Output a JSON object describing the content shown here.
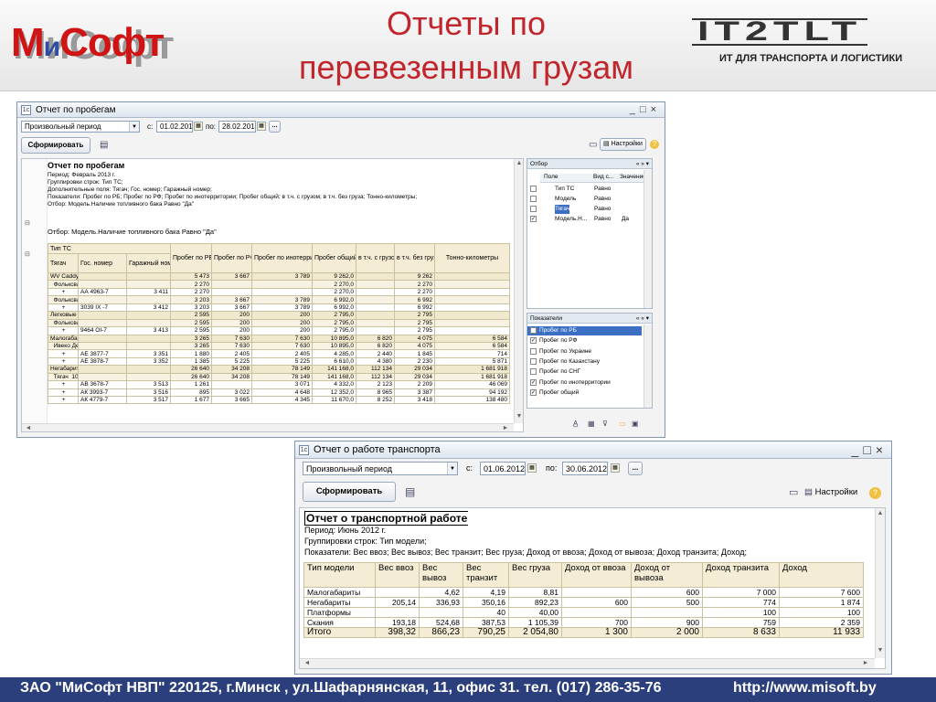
{
  "slide": {
    "logo_left": {
      "m": "М",
      "i": "и",
      "rest": "Софт"
    },
    "title_line1": "Отчеты по",
    "title_line2": "перевезенным грузам",
    "logo_right": {
      "mark": "IT2TLT",
      "subtitle": "ИТ ДЛЯ ТРАНСПОРТА И ЛОГИСТИКИ"
    },
    "footer_left": "ЗАО \"МиСофт НВП\"  220125, г.Минск , ул.Шафарнянская, 11, офис 31. тел. (017) 286-35-76",
    "footer_right": "http://www.misoft.by"
  },
  "win1": {
    "title": "Отчет по пробегам",
    "period_select": "Произвольный период",
    "from_label": "с:",
    "from_date": "01.02.2013",
    "to_label": "по:",
    "to_date": "28.02.2013",
    "ellipsis": "...",
    "generate_button": "Сформировать",
    "settings_button": "Настройки",
    "report": {
      "title": "Отчет по пробегам",
      "lines": [
        "Период: Февраль 2013 г.",
        "Группировки строк: Тип ТС;",
        "Дополнительные поля: Тягач; Гос. номер; Гаражный номер;",
        "Показатели: Пробег по РБ; Пробег по РФ; Пробег по инотерритории; Пробег общий; в т.ч. с грузом; в т.ч. без груза; Тонно-километры;",
        "Отбор: Модель.Наличие топливного бака Равно \"Да\""
      ],
      "filter_line": "Отбор:    Модель.Наличие топливного бака Равно \"Да\"",
      "header": {
        "c1a": "Тип ТС",
        "c1b": "Тягач",
        "c2": "Гос. номер",
        "c3": "Гаражный номер",
        "c4": "Пробег по РБ",
        "c5": "Пробег по РФ",
        "c6": "Пробег по инотерритории",
        "c7": "Пробег общий",
        "c8": "в т.ч. с грузом",
        "c9": "в т.ч. без груза",
        "c10": "Тонно-километры"
      },
      "rows": [
        {
          "g": "g1",
          "a": "WV Caddy",
          "b": "",
          "c": "",
          "d": "5 473",
          "e": "3 667",
          "f": "3 789",
          "h": "9 262,0",
          "i": "",
          "j": "9 262",
          "k": ""
        },
        {
          "g": "g2",
          "a": "  Фольксваген  VW Caddy",
          "b": "",
          "c": "",
          "d": "2 270",
          "e": "",
          "f": "",
          "h": "2 270,0",
          "i": "",
          "j": "2 270",
          "k": ""
        },
        {
          "g": "",
          "a": "       +",
          "b": "АА 4963-7",
          "c": "3 411",
          "d": "2 270",
          "e": "",
          "f": "",
          "h": "2 270,0",
          "i": "",
          "j": "2 270",
          "k": ""
        },
        {
          "g": "g2",
          "a": "  Фольксваген  VW Caddy 2",
          "b": "",
          "c": "",
          "d": "3 203",
          "e": "3 667",
          "f": "3 789",
          "h": "6 992,0",
          "i": "",
          "j": "6 992",
          "k": ""
        },
        {
          "g": "",
          "a": "       +",
          "b": "3039 IX -7",
          "c": "3 412",
          "d": "3 203",
          "e": "3 667",
          "f": "3 789",
          "h": "6 992,0",
          "i": "",
          "j": "6 992",
          "k": ""
        },
        {
          "g": "g1",
          "a": "Легковые",
          "b": "",
          "c": "",
          "d": "2 595",
          "e": "200",
          "f": "200",
          "h": "2 795,0",
          "i": "",
          "j": "2 795",
          "k": ""
        },
        {
          "g": "g2",
          "a": "  Фольксваген",
          "b": "",
          "c": "",
          "d": "2 595",
          "e": "200",
          "f": "200",
          "h": "2 795,0",
          "i": "",
          "j": "2 795",
          "k": ""
        },
        {
          "g": "",
          "a": "       +",
          "b": "9464 OI-7",
          "c": "3 413",
          "d": "2 595",
          "e": "200",
          "f": "200",
          "h": "2 795,0",
          "i": "",
          "j": "2 795",
          "k": ""
        },
        {
          "g": "g1",
          "a": "Малогабариты",
          "b": "",
          "c": "",
          "d": "3 265",
          "e": "7 630",
          "f": "7 630",
          "h": "10 895,0",
          "i": "6 820",
          "j": "4 075",
          "k": "6 584"
        },
        {
          "g": "g2",
          "a": "  Ивеко Дейли",
          "b": "",
          "c": "",
          "d": "3 265",
          "e": "7 630",
          "f": "7 630",
          "h": "10 895,0",
          "i": "6 820",
          "j": "4 075",
          "k": "6 584"
        },
        {
          "g": "",
          "a": "       +",
          "b": "АЕ 3877-7",
          "c": "3 351",
          "d": "1 880",
          "e": "2 405",
          "f": "2 405",
          "h": "4 285,0",
          "i": "2 440",
          "j": "1 845",
          "k": "714"
        },
        {
          "g": "",
          "a": "       +",
          "b": "АЕ 3878-7",
          "c": "3 352",
          "d": "1 385",
          "e": "5 225",
          "f": "5 225",
          "h": "6 610,0",
          "i": "4 380",
          "j": "2 230",
          "k": "5 871"
        },
        {
          "g": "g1",
          "a": "Негабариты",
          "b": "",
          "c": "",
          "d": "26 640",
          "e": "34 208",
          "f": "78 149",
          "h": "141 168,0",
          "i": "112 134",
          "j": "29 034",
          "k": "1 681 918"
        },
        {
          "g": "g2",
          "a": "  Тягач  100 м3",
          "b": "",
          "c": "",
          "d": "26 640",
          "e": "34 208",
          "f": "78 149",
          "h": "141 168,0",
          "i": "112 134",
          "j": "29 034",
          "k": "1 681 918"
        },
        {
          "g": "",
          "a": "       +",
          "b": "АВ 3678-7",
          "c": "3 513",
          "d": "1 261",
          "e": "",
          "f": "3 071",
          "h": "4 332,0",
          "i": "2 123",
          "j": "2 209",
          "k": "46 069"
        },
        {
          "g": "",
          "a": "       +",
          "b": "АК 3993-7",
          "c": "3 516",
          "d": "895",
          "e": "3 022",
          "f": "4 648",
          "h": "12 352,0",
          "i": "8 965",
          "j": "3 387",
          "k": "94 192"
        },
        {
          "g": "",
          "a": "       +",
          "b": "АК 4779-7",
          "c": "3 517",
          "d": "1 677",
          "e": "3 665",
          "f": "4 345",
          "h": "11 670,0",
          "i": "8 252",
          "j": "3 418",
          "k": "138 480"
        }
      ]
    },
    "filter_panel": {
      "title": "Отбор",
      "arrows": "« » ▾",
      "col_field": "Поле",
      "col_type": "Вид с...",
      "col_value": "Значение",
      "rows": [
        {
          "field": "Тип ТС",
          "type": "Равно",
          "value": "",
          "checked": ""
        },
        {
          "field": "Модель",
          "type": "Равно",
          "value": "",
          "checked": ""
        },
        {
          "field": "Тягач",
          "type": "Равно",
          "value": "",
          "checked": ""
        },
        {
          "field": "Модель.Н...",
          "type": "Равно",
          "value": "Да",
          "checked": "✓"
        }
      ]
    },
    "indicators_panel": {
      "title": "Показатели",
      "arrows": "« » ▾",
      "items": [
        {
          "label": "Пробег по РБ",
          "checked": "✓"
        },
        {
          "label": "Пробег по РФ",
          "checked": "✓"
        },
        {
          "label": "Пробег по Украине",
          "checked": ""
        },
        {
          "label": "Пробег по Казахстану",
          "checked": ""
        },
        {
          "label": "Пробег по СНГ",
          "checked": ""
        },
        {
          "label": "Пробег по инотерритории",
          "checked": "✓"
        },
        {
          "label": "Пробег общий",
          "checked": "✓"
        }
      ]
    }
  },
  "win2": {
    "title": "Отчет о работе транспорта",
    "period_select": "Произвольный период",
    "from_label": "с:",
    "from_date": "01.06.2012",
    "to_label": "по:",
    "to_date": "30.06.2012",
    "ellipsis": "...",
    "generate_button": "Сформировать",
    "settings_button": "Настройки",
    "report": {
      "title": "Отчет о транспортной работе",
      "lines": [
        "Период: Июнь 2012 г.",
        "Группировки строк: Тип модели;",
        "Показатели: Вес ввоз; Вес вывоз; Вес транзит; Вес груза; Доход от ввоза; Доход от вывоза; Доход транзита; Доход;"
      ],
      "header": [
        "Тип модели",
        "Вес ввоз",
        "Вес вывоз",
        "Вес транзит",
        "Вес груза",
        "Доход от ввоза",
        "Доход от вывоза",
        "Доход транзита",
        "Доход"
      ],
      "rows": [
        [
          "Малогабариты",
          "",
          "4,62",
          "4,19",
          "8,81",
          "",
          "600",
          "7 000",
          "7 600"
        ],
        [
          "Негабариты",
          "205,14",
          "336,93",
          "350,16",
          "892,23",
          "600",
          "500",
          "774",
          "1 874"
        ],
        [
          "Платформы",
          "",
          "",
          "40",
          "40,00",
          "",
          "",
          "100",
          "100"
        ],
        [
          "Скания",
          "193,18",
          "524,68",
          "387,53",
          "1 105,39",
          "700",
          "900",
          "759",
          "2 359"
        ]
      ],
      "total": [
        "Итого",
        "398,32",
        "866,23",
        "790,25",
        "2 054,80",
        "1 300",
        "2 000",
        "8 633",
        "11 933"
      ]
    }
  }
}
